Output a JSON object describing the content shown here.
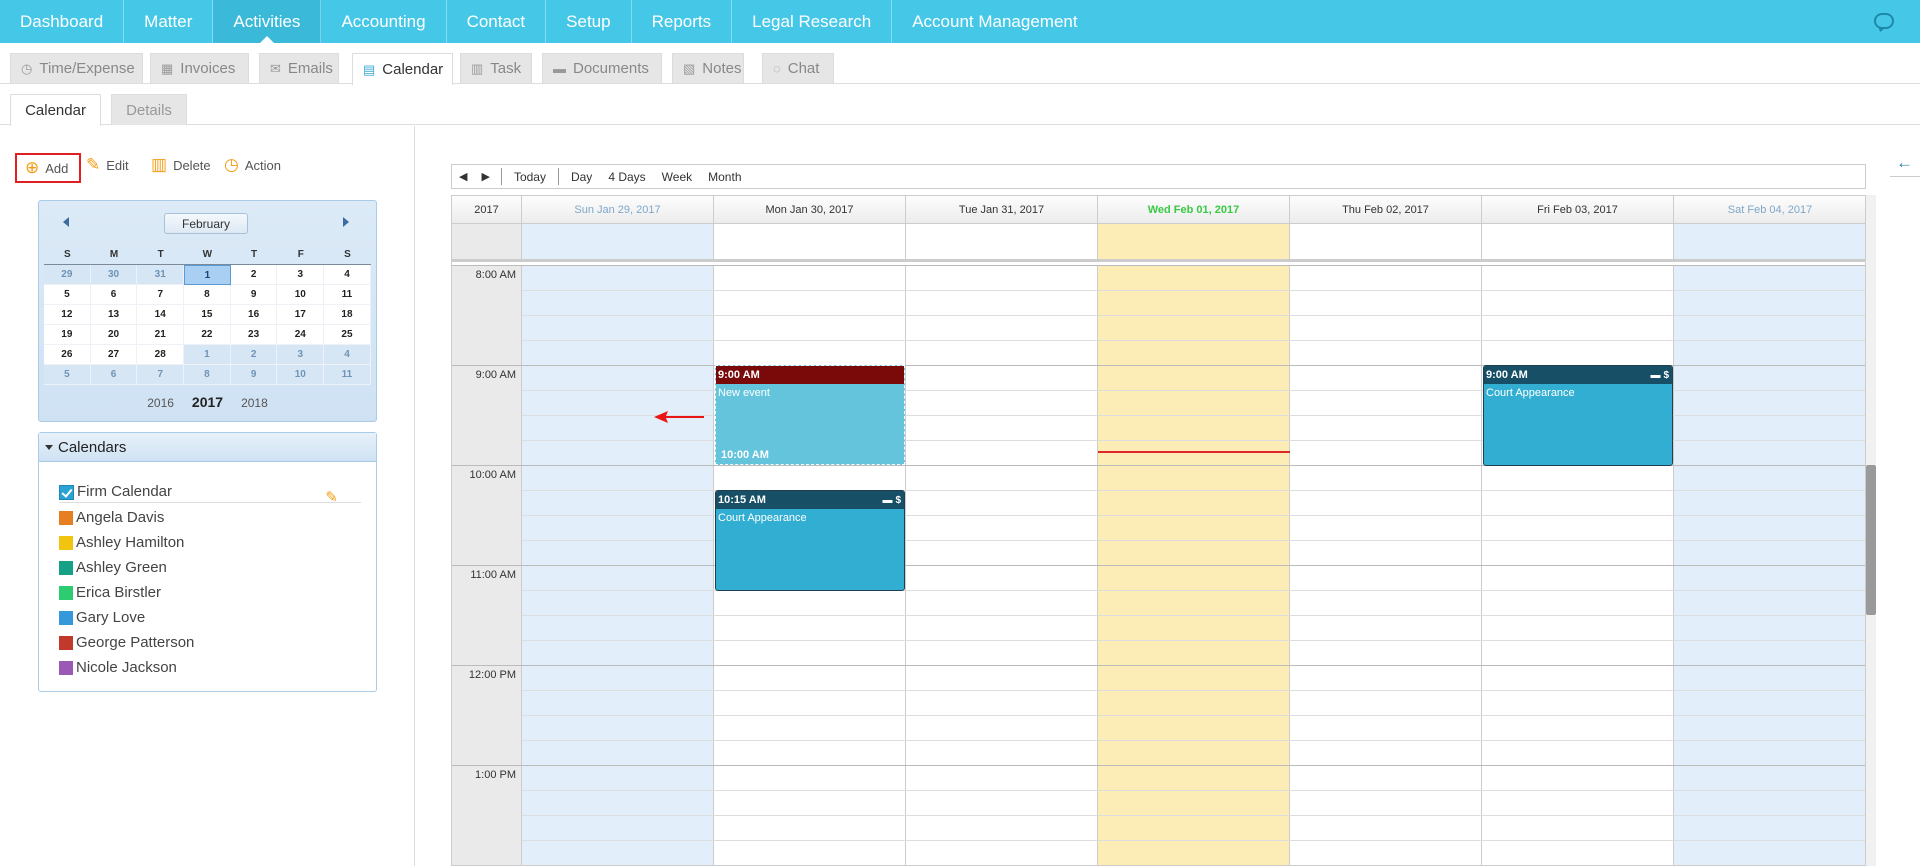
{
  "topnav": {
    "items": [
      "Dashboard",
      "Matter",
      "Activities",
      "Accounting",
      "Contact",
      "Setup",
      "Reports",
      "Legal Research",
      "Account Management"
    ],
    "active": "Activities"
  },
  "subtabs": {
    "items": [
      {
        "label": "Time/Expense",
        "icon": "clock-icon"
      },
      {
        "label": "Invoices",
        "icon": "calculator-icon"
      },
      {
        "label": "Emails",
        "icon": "envelope-icon"
      },
      {
        "label": "Calendar",
        "icon": "calendar-icon"
      },
      {
        "label": "Task",
        "icon": "task-icon"
      },
      {
        "label": "Documents",
        "icon": "folder-icon"
      },
      {
        "label": "Notes",
        "icon": "note-icon"
      },
      {
        "label": "Chat",
        "icon": "chat-icon"
      }
    ],
    "active": "Calendar"
  },
  "viewtabs": {
    "calendar": "Calendar",
    "details": "Details"
  },
  "toolbar": {
    "add": "Add",
    "edit": "Edit",
    "delete": "Delete",
    "action": "Action"
  },
  "mini_calendar": {
    "month": "February",
    "weekday_headers": [
      "S",
      "M",
      "T",
      "W",
      "T",
      "F",
      "S"
    ],
    "weeks": [
      [
        "29",
        "30",
        "31",
        "1",
        "2",
        "3",
        "4"
      ],
      [
        "5",
        "6",
        "7",
        "8",
        "9",
        "10",
        "11"
      ],
      [
        "12",
        "13",
        "14",
        "15",
        "16",
        "17",
        "18"
      ],
      [
        "19",
        "20",
        "21",
        "22",
        "23",
        "24",
        "25"
      ],
      [
        "26",
        "27",
        "28",
        "1",
        "2",
        "3",
        "4"
      ],
      [
        "5",
        "6",
        "7",
        "8",
        "9",
        "10",
        "11"
      ]
    ],
    "years": [
      "2016",
      "2017",
      "2018"
    ],
    "current_year": "2017"
  },
  "calendars": {
    "title": "Calendars",
    "firm": "Firm Calendar",
    "people": [
      {
        "name": "Angela Davis",
        "color": "#e67e22"
      },
      {
        "name": "Ashley Hamilton",
        "color": "#f1c40f"
      },
      {
        "name": "Ashley Green",
        "color": "#16a085"
      },
      {
        "name": "Erica Birstler",
        "color": "#2ecc71"
      },
      {
        "name": "Gary Love",
        "color": "#3498db"
      },
      {
        "name": "George Patterson",
        "color": "#c0392b"
      },
      {
        "name": "Nicole Jackson",
        "color": "#9b59b6"
      }
    ]
  },
  "scheduler": {
    "toolbar": {
      "prev": "◀",
      "next": "▶",
      "today": "Today",
      "day": "Day",
      "four_days": "4 Days",
      "week": "Week",
      "month": "Month"
    },
    "year": "2017",
    "days": [
      "Sun Jan 29, 2017",
      "Mon Jan 30, 2017",
      "Tue Jan 31, 2017",
      "Wed Feb 01, 2017",
      "Thu Feb 02, 2017",
      "Fri Feb 03, 2017",
      "Sat Feb 04, 2017"
    ],
    "times": [
      "8:00 AM",
      "9:00 AM",
      "10:00 AM",
      "11:00 AM",
      "12:00 PM",
      "1:00 PM"
    ],
    "events": {
      "new_event": {
        "start": "9:00 AM",
        "title": "New event",
        "end": "10:00 AM"
      },
      "mon_court": {
        "start": "10:15 AM",
        "title": "Court Appearance",
        "icons": "folder-icon dollar-icon"
      },
      "fri_court": {
        "start": "9:00 AM",
        "title": "Court Appearance",
        "icons": "folder-icon dollar-icon"
      }
    },
    "colors": {
      "weekend": "#e2eefa",
      "today": "#fcedb7",
      "today_header": "#3ac944",
      "event": "#31aed1",
      "event_head": "#164f66",
      "new_event_head": "#7a0a0a"
    }
  }
}
